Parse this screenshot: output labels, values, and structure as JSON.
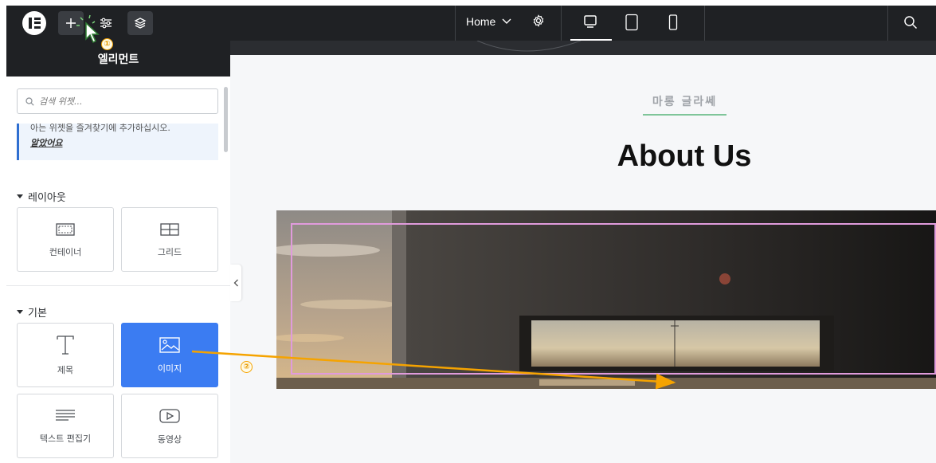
{
  "topbar": {
    "page_name": "Home",
    "accent_color": "#3b7cf2"
  },
  "panel": {
    "title": "엘리먼트",
    "search_placeholder": "검색 위젯...",
    "notice_text": "아는 위젯을 즐겨찾기에 추가하십시오.",
    "notice_link": "알았어요",
    "sections": [
      {
        "label": "레이아웃",
        "widgets": [
          {
            "label": "컨테이너",
            "icon": "container-icon"
          },
          {
            "label": "그리드",
            "icon": "grid-icon"
          }
        ]
      },
      {
        "label": "기본",
        "widgets": [
          {
            "label": "제목",
            "icon": "heading-icon"
          },
          {
            "label": "이미지",
            "icon": "image-icon",
            "active": true
          },
          {
            "label": "텍스트 편집기",
            "icon": "text-editor-icon"
          },
          {
            "label": "동영상",
            "icon": "video-icon"
          }
        ]
      }
    ]
  },
  "canvas": {
    "eyebrow": "마롱 글라쎄",
    "heading": "About Us",
    "eyebrow_line_color": "#7fc59a",
    "selection_color": "#e09bdc"
  },
  "annotations": {
    "step1": "①",
    "step2": "②",
    "color": "#f5a300"
  }
}
